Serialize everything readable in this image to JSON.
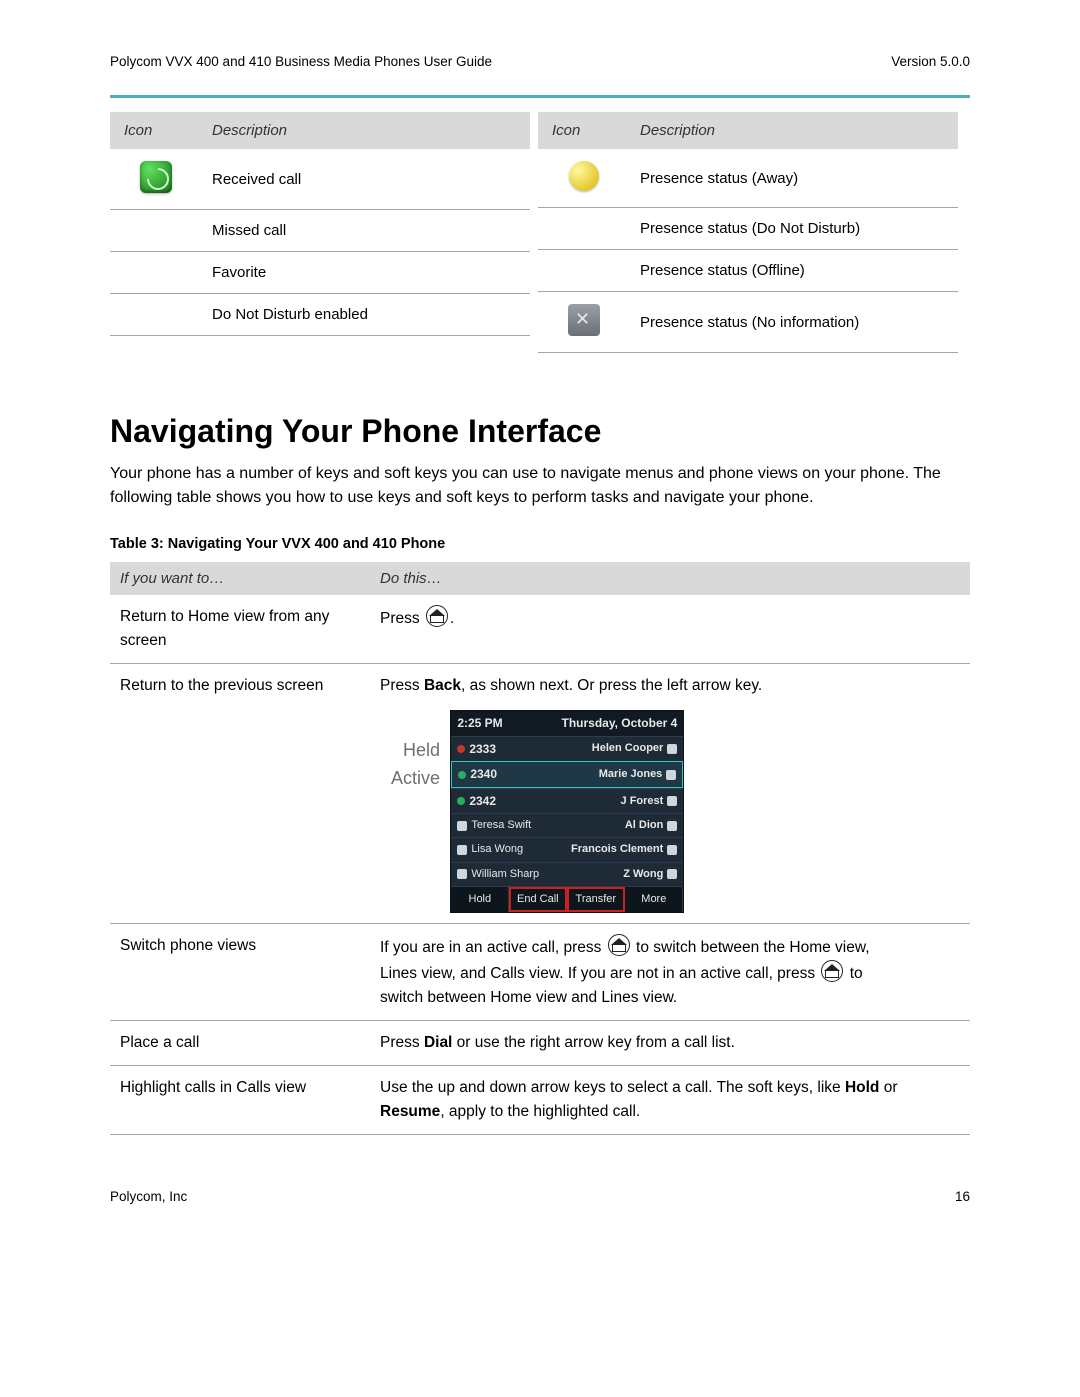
{
  "header": {
    "title": "Polycom VVX 400 and 410 Business Media Phones User Guide",
    "version": "Version 5.0.0"
  },
  "icon_table": {
    "headers": {
      "icon": "Icon",
      "desc": "Description"
    },
    "left": [
      {
        "desc": "Received call",
        "icon": "received-call-icon"
      },
      {
        "desc": "Missed call",
        "icon": ""
      },
      {
        "desc": "Favorite",
        "icon": ""
      },
      {
        "desc": "Do Not Disturb enabled",
        "icon": ""
      }
    ],
    "right": [
      {
        "desc": "Presence status (Away)",
        "icon": "presence-away-icon"
      },
      {
        "desc": "Presence status (Do Not Disturb)",
        "icon": ""
      },
      {
        "desc": "Presence status (Offline)",
        "icon": ""
      },
      {
        "desc": "Presence status (No information)",
        "icon": "presence-noinfo-icon"
      }
    ]
  },
  "section": {
    "heading": "Navigating Your Phone Interface",
    "paragraph": "Your phone has a number of keys and soft keys you can use to navigate menus and phone views on your phone. The following table shows you how to use keys and soft keys to perform tasks and navigate your phone.",
    "table_caption": "Table 3: Navigating Your VVX 400 and 410 Phone"
  },
  "nav_table": {
    "headers": {
      "want": "If you want to…",
      "do": "Do this…"
    },
    "rows": {
      "home": {
        "want": "Return to Home view from any screen",
        "do_prefix": "Press ",
        "do_suffix": "."
      },
      "back": {
        "want": "Return to the previous screen",
        "do_prefix": "Press ",
        "do_bold": "Back",
        "do_suffix": ", as shown next. Or press the left arrow key."
      },
      "switch": {
        "want": "Switch phone views",
        "p1a": "If you are in an active call, press ",
        "p1b": " to switch between the Home view,",
        "p2a": "Lines view, and Calls view. If you are not in an active call, press ",
        "p2b": " to",
        "p3": "switch between Home view and Lines view."
      },
      "place": {
        "want": "Place a call",
        "do_prefix": "Press ",
        "do_bold": "Dial",
        "do_suffix": " or use the right arrow key from a call list."
      },
      "highlight": {
        "want": "Highlight calls in Calls view",
        "p1a": "Use the up and down arrow keys to select a call. The soft keys, like ",
        "p1b": "Hold",
        "p1c": " or ",
        "p2a": "Resume",
        "p2b": ", apply to the highlighted call."
      }
    }
  },
  "phone_screenshot": {
    "time": "2:25 PM",
    "date": "Thursday, October 4",
    "labels": {
      "held": "Held",
      "active": "Active"
    },
    "lines_left": [
      {
        "num": "2333",
        "state": "held"
      },
      {
        "num": "2340",
        "state": "active"
      },
      {
        "num": "2342",
        "state": "idle"
      },
      {
        "name": "Teresa Swift"
      },
      {
        "name": "Lisa Wong"
      },
      {
        "name": "William Sharp"
      }
    ],
    "lines_right": [
      "Helen Cooper",
      "Marie Jones",
      "J Forest",
      "Al Dion",
      "Francois Clement",
      "Z Wong"
    ],
    "softkeys": [
      "Hold",
      "End Call",
      "Transfer",
      "More"
    ]
  },
  "footer": {
    "company": "Polycom, Inc",
    "page": "16"
  }
}
